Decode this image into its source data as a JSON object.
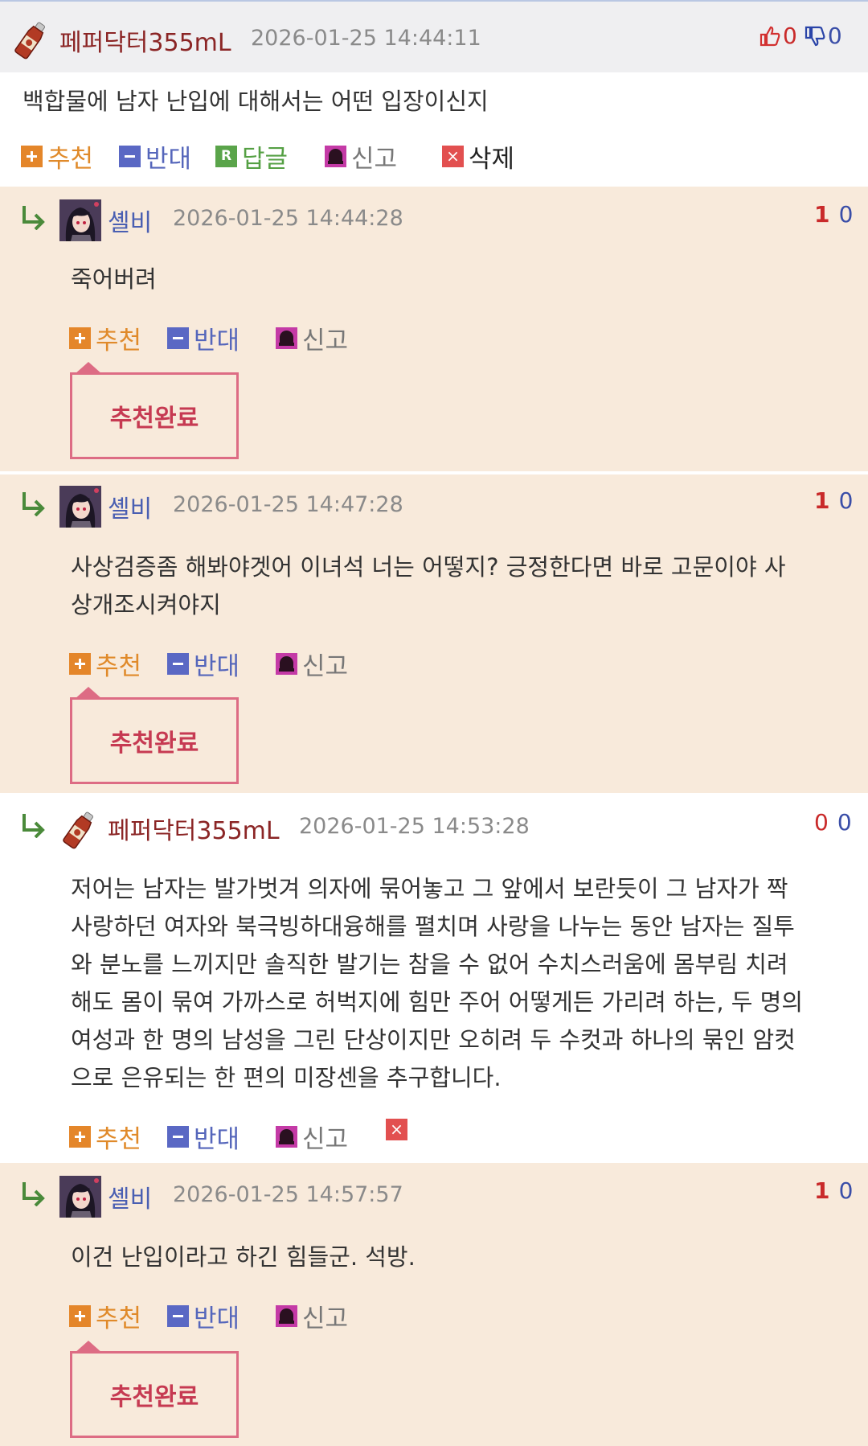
{
  "root": {
    "author": "페퍼닥터355mL",
    "date": "2026-01-25 14:44:11",
    "up": "0",
    "down": "0",
    "text": "백합물에 남자 난입에 대해서는 어떤 입장이신지",
    "actions": {
      "recommend": "추천",
      "oppose": "반대",
      "reply": "답글",
      "report": "신고",
      "delete": "삭제"
    }
  },
  "replies": [
    {
      "author": "셸비",
      "date": "2026-01-25 14:44:28",
      "up": "1",
      "down": "0",
      "lines": [
        "죽어버려"
      ],
      "actions": {
        "recommend": "추천",
        "oppose": "반대",
        "report": "신고"
      },
      "popup": "추천완료"
    },
    {
      "author": "셸비",
      "date": "2026-01-25 14:47:28",
      "up": "1",
      "down": "0",
      "lines": [
        "사상검증좀 해봐야겟어 이녀석 너는 어떻지? 긍정한다면 바로 고문이야 사",
        "상개조시켜야지"
      ],
      "actions": {
        "recommend": "추천",
        "oppose": "반대",
        "report": "신고"
      },
      "popup": "추천완료"
    },
    {
      "author": "페퍼닥터355mL",
      "date": "2026-01-25 14:53:28",
      "up": "0",
      "down": "0",
      "lines": [
        "저어는 남자는 발가벗겨 의자에 묶어놓고 그 앞에서 보란듯이 그 남자가 짝",
        "사랑하던 여자와 북극빙하대융해를 펼치며 사랑을 나누는 동안 남자는 질투",
        "와 분노를 느끼지만 솔직한 발기는 참을 수 없어 수치스러움에 몸부림 치려",
        "해도 몸이 묶여 가까스로 허벅지에 힘만 주어 어떻게든 가리려 하는, 두 명의",
        "여성과 한 명의 남성을 그린 단상이지만 오히려 두 수컷과 하나의 묶인 암컷",
        "으로 은유되는 한 편의 미장센을 추구합니다."
      ],
      "actions": {
        "recommend": "추천",
        "oppose": "반대",
        "report": "신고"
      }
    },
    {
      "author": "셸비",
      "date": "2026-01-25 14:57:57",
      "up": "1",
      "down": "0",
      "lines": [
        "이건 난입이라고 하긴 힘들군. 석방."
      ],
      "actions": {
        "recommend": "추천",
        "oppose": "반대",
        "report": "신고"
      },
      "popup": "추천완료"
    }
  ],
  "colors": {
    "reply_bg": "#f8eadb",
    "author_name": "#8b2525",
    "user_name": "#4a5fb2",
    "upvote": "#c92a2a",
    "downvote": "#3a4ea8",
    "popup_border": "#dd6c84"
  },
  "icons": {
    "reply_arrow": "reply-arrow-icon",
    "bottle_avatar": "pepper-bottle-avatar",
    "user_avatar": "anime-girl-avatar",
    "thumb_up": "thumb-up-icon",
    "thumb_down": "thumb-down-icon"
  }
}
